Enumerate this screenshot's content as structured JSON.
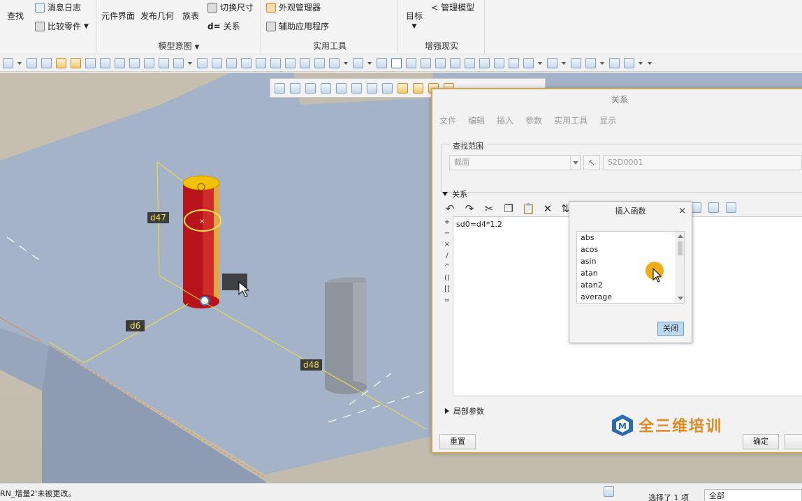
{
  "ribbon": {
    "search_label": "查找",
    "msg_log": "消息日志",
    "compare_parts": "比较零件",
    "component_ui": "元件界面",
    "publish_geom": "发布几何",
    "family_table": "族表",
    "switch_dim": "切换尺寸",
    "relations": "关系",
    "design_intent_group": "模型意图",
    "appearance_mgr": "外观管理器",
    "aux_apps": "辅助应用程序",
    "utilities_group": "实用工具",
    "target": "目标",
    "manage_model": "管理模型",
    "ar_group": "增强现实"
  },
  "viewport": {
    "dims": {
      "d47": "d47",
      "d6": "d6",
      "d48": "d48"
    }
  },
  "dialog": {
    "title": "关系",
    "menu": [
      "文件",
      "编辑",
      "插入",
      "参数",
      "实用工具",
      "显示"
    ],
    "lookup_label": "查找范围",
    "scope_value": "截面",
    "id_value": "S2D0001",
    "relations_header": "关系",
    "relation_text": "sd0=d4*1.2",
    "operators": [
      "+",
      "−",
      "×",
      "/",
      "^",
      "()",
      "[]",
      "="
    ],
    "local_params": "局部参数",
    "reset_button": "重置",
    "ok_button": "确定"
  },
  "insert_function": {
    "title": "插入函数",
    "items": [
      "abs",
      "acos",
      "asin",
      "atan",
      "atan2",
      "average"
    ],
    "close_button": "关闭"
  },
  "status": {
    "message": "RN_增量2'未被更改。",
    "selected": "选择了 1 项",
    "filter": "全部"
  },
  "watermark": {
    "text": "全三维培训"
  },
  "colors": {
    "accent": "#2b6cb0",
    "cylinder_red": "#c0141c",
    "dim_yellow": "#f0e040",
    "plate": "#a7b4c8"
  }
}
